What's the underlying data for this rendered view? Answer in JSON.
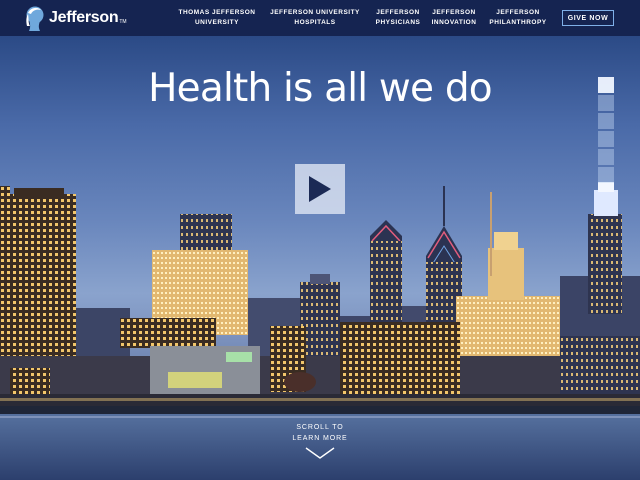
{
  "brand": {
    "name": "Jefferson",
    "trademark": "TM",
    "icon": "jefferson-head-logo-icon"
  },
  "nav": {
    "items": [
      {
        "line1": "THOMAS JEFFERSON",
        "line2": "UNIVERSITY"
      },
      {
        "line1": "JEFFERSON UNIVERSITY",
        "line2": "HOSPITALS"
      },
      {
        "line1": "JEFFERSON",
        "line2": "PHYSICIANS"
      },
      {
        "line1": "JEFFERSON",
        "line2": "INNOVATION"
      },
      {
        "line1": "JEFFERSON",
        "line2": "PHILANTHROPY"
      }
    ],
    "give_now_label": "GIVE NOW"
  },
  "hero": {
    "headline": "Health is all we do",
    "play_icon": "play-icon",
    "slides": {
      "count": 6,
      "active_index": 0
    },
    "scroll_line1": "SCROLL TO",
    "scroll_line2": "LEARN MORE",
    "scroll_icon": "chevron-down-icon"
  },
  "colors": {
    "header_bg": "#152451",
    "give_now_border": "#7fb0e8",
    "play_arrow": "#1b2a55"
  }
}
